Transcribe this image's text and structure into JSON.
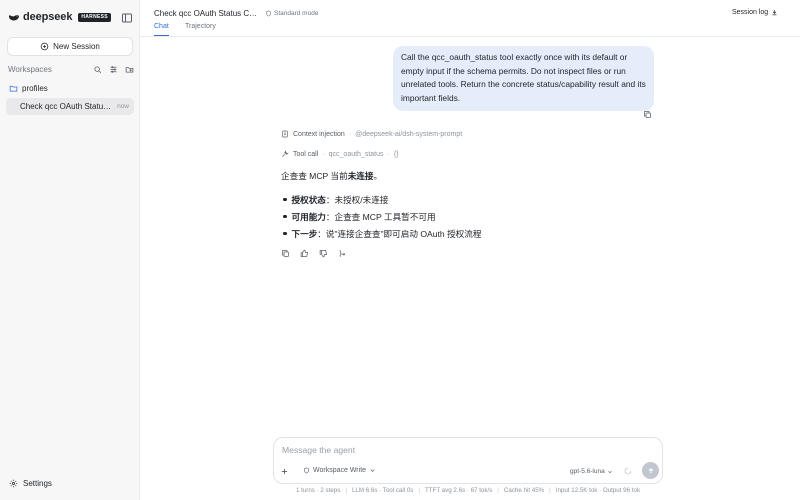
{
  "sidebar": {
    "brand": "deepseek",
    "badge": "HARNESS",
    "new_session": "New Session",
    "workspaces_label": "Workspaces",
    "folder": "profiles",
    "session": {
      "title": "Check qcc OAuth Status Ca...",
      "time": "now"
    },
    "settings": "Settings"
  },
  "header": {
    "title": "Check qcc OAuth Status Capa...",
    "mode": "Standard mode",
    "tabs": [
      {
        "label": "Chat",
        "active": true
      },
      {
        "label": "Trajectory",
        "active": false
      }
    ],
    "session_log": "Session log"
  },
  "user_message": "Call the qcc_oauth_status tool exactly once with its default or empty input if the schema permits. Do not inspect files or run unrelated tools. Return the concrete status/capability result and its important fields.",
  "assistant": {
    "context": {
      "label": "Context injection",
      "value": "@deepseek-ai/dsh-system-prompt"
    },
    "tool_call": {
      "label": "Tool call",
      "name": "qcc_oauth_status",
      "args": "{}"
    },
    "answer_prefix": "企查查 MCP 当前",
    "answer_bold": "未连接",
    "answer_suffix": "。",
    "bullets": [
      {
        "key": "授权状态",
        "value": "：未授权/未连接"
      },
      {
        "key": "可用能力",
        "value": "：企查查 MCP 工具暂不可用"
      },
      {
        "key": "下一步",
        "value": "：说\"连接企查查\"即可启动 OAuth 授权流程"
      }
    ]
  },
  "composer": {
    "placeholder": "Message the agent",
    "permission": "Workspace Write",
    "model": "gpt-5.6-luna"
  },
  "stats": {
    "turns": "1 turns · 2 steps",
    "llm": "LLM 6.6s · Tool call 0s",
    "ttft": "TTFT avg 2.6s · 67 tok/s",
    "cache": "Cache hit 45%",
    "tokens": "Input 12.5K tok · Output 96 tok"
  },
  "colors": {
    "accent": "#2f6fd6",
    "user_bubble": "#e5edfb",
    "sidebar_bg": "#f7f7f8"
  }
}
